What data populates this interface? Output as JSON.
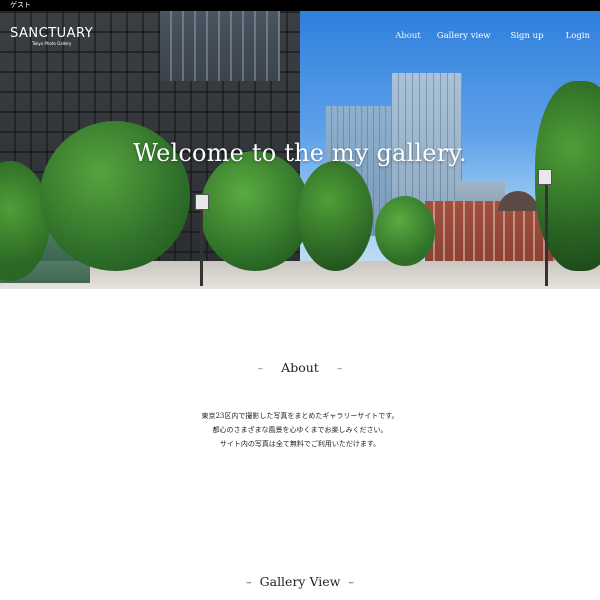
{
  "topbar": {
    "user_label": "ゲスト"
  },
  "header": {
    "logo_main": "SANCTUARY",
    "logo_sub": "Tokyo Photo Gallery",
    "nav": {
      "about": "About",
      "gallery": "Gallery view",
      "signup": "Sign up",
      "login": "Login"
    }
  },
  "hero": {
    "title": "Welcome to the my gallery."
  },
  "about": {
    "dash_left": "–",
    "title": "About",
    "dash_right": "–",
    "lines": [
      "東京23区内で撮影した写真をまとめたギャラリーサイトです。",
      "都心のさまざまな風景を心ゆくまでお楽しみください。",
      "サイト内の写真は全て無料でご利用いただけます。"
    ]
  },
  "gallery": {
    "dash_left": "–",
    "title": "Gallery View",
    "dash_right": "–"
  }
}
